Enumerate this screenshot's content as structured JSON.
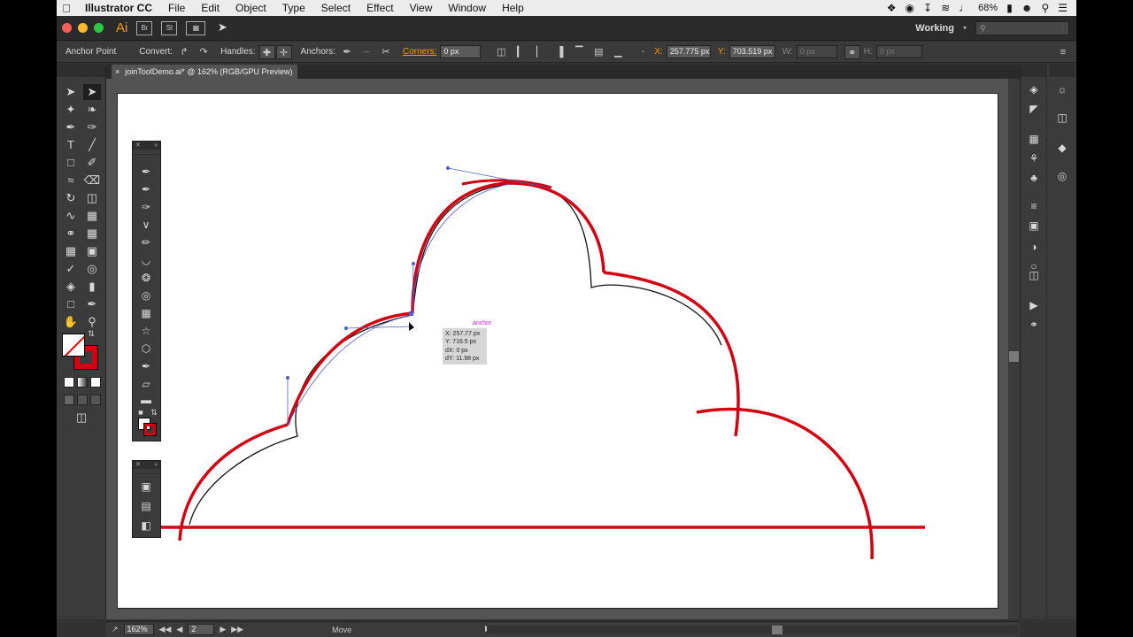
{
  "menubar": {
    "app_name": "Illustrator CC",
    "items": [
      "File",
      "Edit",
      "Object",
      "Type",
      "Select",
      "Effect",
      "View",
      "Window",
      "Help"
    ],
    "battery": "68%"
  },
  "appbar": {
    "logo": "Ai",
    "bridge": "Br",
    "stock": "St",
    "workspace": "Working",
    "search_placeholder": ""
  },
  "controlbar": {
    "tool_name": "Anchor Point",
    "convert_label": "Convert:",
    "handles_label": "Handles:",
    "anchors_label": "Anchors:",
    "corners_label": "Corners:",
    "corners_value": "0 px",
    "x_label": "X:",
    "x_value": "257.775 px",
    "y_label": "Y:",
    "y_value": "703.519 px",
    "w_label": "W:",
    "w_value": "0 px",
    "h_label": "H:",
    "h_value": "0 px"
  },
  "document": {
    "tab_title": "joinToolDemo.ai* @ 162% (RGB/GPU Preview)",
    "close_glyph": "×"
  },
  "readout": {
    "x": "X: 257.77 px",
    "y": "Y: 716.5 px",
    "dx": "dX: 0 px",
    "dy": "dY: 11.98 px",
    "hint": "anchor"
  },
  "statusbar": {
    "zoom": "162%",
    "artboard": "2",
    "tool": "Move"
  },
  "colors": {
    "stroke": "#d40012",
    "accent": "#ff9a00",
    "path_selection": "#4a5fc1"
  },
  "icons": {
    "selection": "selection-tool-icon",
    "direct_selection": "direct-selection-tool-icon",
    "pen": "pen-tool-icon",
    "type": "type-tool-icon",
    "hand": "hand-tool-icon",
    "zoom": "zoom-tool-icon"
  }
}
